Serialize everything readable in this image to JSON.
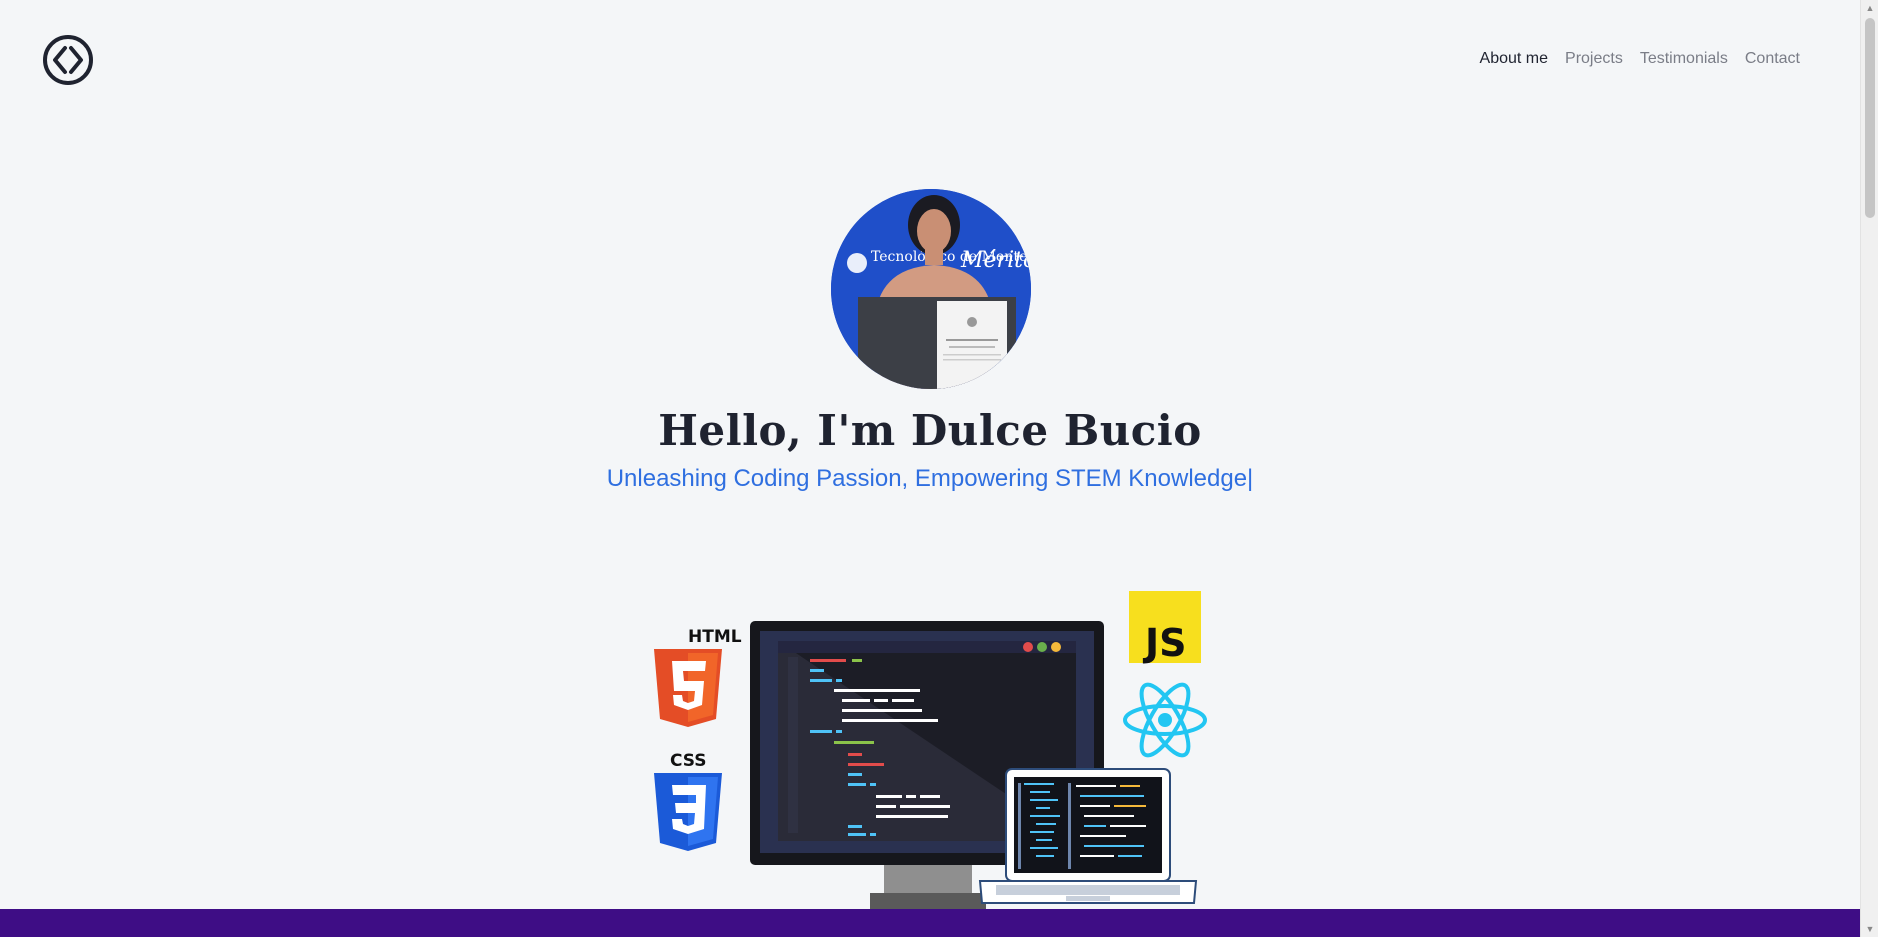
{
  "header": {
    "logo_icon": "code-brackets-icon",
    "nav": [
      {
        "label": "About me",
        "active": true
      },
      {
        "label": "Projects",
        "active": false
      },
      {
        "label": "Testimonials",
        "active": false
      },
      {
        "label": "Contact",
        "active": false
      }
    ]
  },
  "hero": {
    "title": "Hello, I'm Dulce Bucio",
    "subtitle": "Unleashing Coding Passion, Empowering STEM Knowledge|",
    "photo_text_left": "Tecnológico de Monterrey",
    "photo_text_right": "Mérito Académico"
  },
  "illustration": {
    "html_badge": "HTML",
    "css_badge": "CSS",
    "js_badge": "JS"
  },
  "colors": {
    "accent": "#2f6fe0",
    "band": "#3e0d85",
    "background": "#f4f6f8"
  }
}
